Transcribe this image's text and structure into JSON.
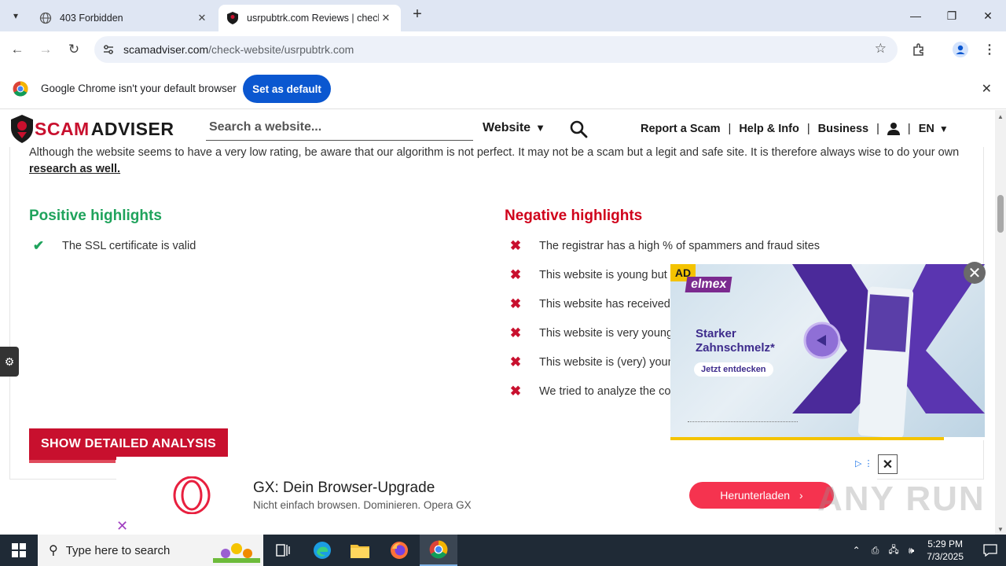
{
  "browser": {
    "tabs": [
      {
        "title": "403 Forbidden",
        "active": false
      },
      {
        "title": "usrpubtrk.com Reviews | check",
        "active": true
      }
    ],
    "url_host": "scamadviser.com",
    "url_path": "/check-website/usrpubtrk.com",
    "infobar": {
      "message": "Google Chrome isn't your default browser",
      "button": "Set as default"
    }
  },
  "site": {
    "logo_part1": "SCAM",
    "logo_part2": "ADVISER",
    "search_placeholder": "Search a website...",
    "search_type": "Website",
    "nav": {
      "report": "Report a Scam",
      "help": "Help & Info",
      "business": "Business",
      "lang": "EN"
    },
    "disclaimer_text": "Although the website seems to have a very low rating, be aware that our algorithm is not perfect. It may not be a scam but a legit and safe site. It is therefore always wise to do your own ",
    "disclaimer_link": "research as well.",
    "positive_title": "Positive highlights",
    "positive_items": [
      "The SSL certificate is valid"
    ],
    "negative_title": "Negative highlights",
    "negative_items": [
      "The registrar has a high % of spammers and fraud sites",
      "This website is young but a",
      "This website has received (",
      "This website is very young",
      "This website is (very) youn",
      "We tried to analyze the cor"
    ],
    "show_analysis": "SHOW DETAILED ANALYSIS"
  },
  "video_ad": {
    "label": "AD",
    "brand": "elmex",
    "claim_line1": "Starker",
    "claim_line2": "Zahnschmelz*",
    "cta": "Jetzt entdecken",
    "progress_fraction": 0.87
  },
  "banner_ad": {
    "headline": "GX: Dein Browser-Upgrade",
    "subline": "Nicht einfach browsen. Dominieren. Opera GX",
    "button": "Herunterladen"
  },
  "watermark": "ANY RUN",
  "taskbar": {
    "search_placeholder": "Type here to search",
    "time": "5:29 PM",
    "date": "7/3/2025"
  },
  "colors": {
    "brand_red": "#c8102e",
    "positive_green": "#1fa35c",
    "chrome_blue": "#0b57d0",
    "opera_red": "#f5334f"
  }
}
